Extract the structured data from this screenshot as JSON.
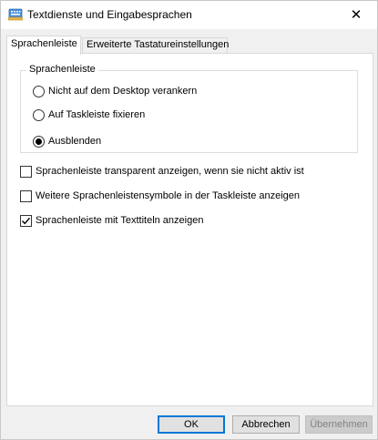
{
  "window": {
    "title": "Textdienste und Eingabesprachen",
    "close_glyph": "✕"
  },
  "tabs": [
    {
      "label": "Sprachenleiste",
      "active": true
    },
    {
      "label": "Erweiterte Tastatureinstellungen",
      "active": false
    }
  ],
  "group": {
    "legend": "Sprachenleiste",
    "options": [
      {
        "label": "Nicht auf dem Desktop verankern",
        "checked": false
      },
      {
        "label": "Auf Taskleiste fixieren",
        "checked": false
      },
      {
        "label": "Ausblenden",
        "checked": true
      }
    ]
  },
  "checkboxes": [
    {
      "label": "Sprachenleiste transparent anzeigen, wenn sie nicht aktiv ist",
      "checked": false
    },
    {
      "label": "Weitere Sprachenleistensymbole in der Taskleiste anzeigen",
      "checked": false
    },
    {
      "label": "Sprachenleiste mit Texttiteln anzeigen",
      "checked": true
    }
  ],
  "buttons": {
    "ok": "OK",
    "cancel": "Abbrechen",
    "apply": "Übernehmen"
  },
  "icons": {
    "app": "keyboard-language-icon",
    "close": "close-icon",
    "check": "checkmark-icon"
  },
  "colors": {
    "accent": "#0078d7",
    "window_bg": "#f0f0f0",
    "panel_bg": "#ffffff"
  }
}
